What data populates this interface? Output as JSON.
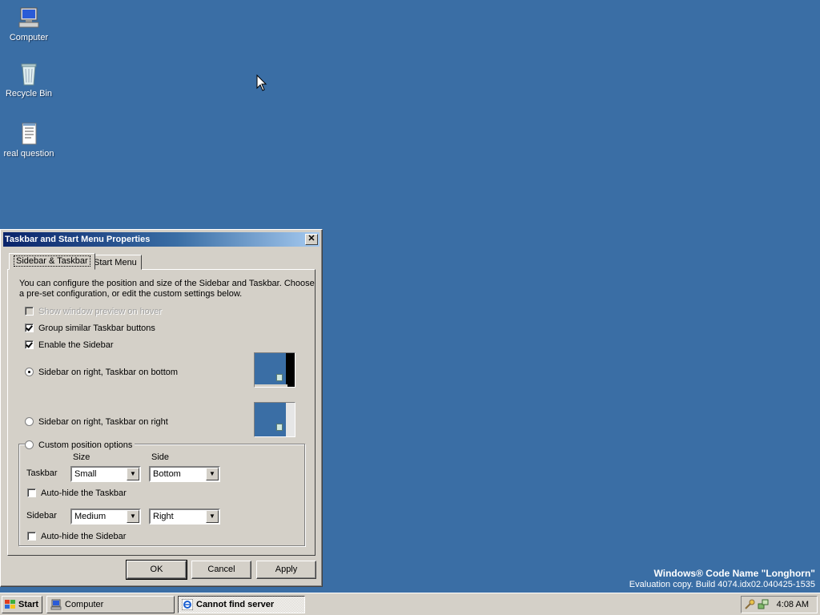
{
  "desktop": {
    "icons": [
      {
        "label": "Computer",
        "icon": "computer-icon"
      },
      {
        "label": "Recycle Bin",
        "icon": "recycle-bin-icon"
      },
      {
        "label": "real question",
        "icon": "text-document-icon"
      }
    ],
    "background_color": "#3a6ea5"
  },
  "dialog": {
    "title": "Taskbar and Start Menu Properties",
    "tabs": [
      {
        "label": "Sidebar & Taskbar",
        "active": true
      },
      {
        "label": "Start Menu",
        "active": false
      }
    ],
    "intro_text": "You can configure the position and size of the Sidebar and Taskbar. Choose a pre-set configuration, or edit the custom settings below.",
    "options": {
      "show_preview": {
        "label": "Show window preview on hover",
        "checked": false,
        "disabled": true
      },
      "group_buttons": {
        "label": "Group similar Taskbar buttons",
        "checked": true
      },
      "enable_sidebar": {
        "label": "Enable the Sidebar",
        "checked": true
      }
    },
    "layouts": {
      "right_bottom": {
        "label": "Sidebar on right, Taskbar on bottom",
        "selected": true
      },
      "right_right": {
        "label": "Sidebar on right, Taskbar on right",
        "selected": false
      },
      "custom": {
        "label": "Custom position options",
        "selected": false
      }
    },
    "custom": {
      "size_header": "Size",
      "side_header": "Side",
      "taskbar_label": "Taskbar",
      "taskbar_size": "Small",
      "taskbar_side": "Bottom",
      "autohide_taskbar": {
        "label": "Auto-hide the Taskbar",
        "checked": false
      },
      "sidebar_label": "Sidebar",
      "sidebar_size": "Medium",
      "sidebar_side": "Right",
      "autohide_sidebar": {
        "label": "Auto-hide the Sidebar",
        "checked": false
      }
    },
    "buttons": {
      "ok": "OK",
      "cancel": "Cancel",
      "apply": "Apply"
    }
  },
  "watermark": {
    "line1": "Windows® Code Name \"Longhorn\"",
    "line2": "Evaluation copy. Build 4074.idx02.040425-1535"
  },
  "taskbar": {
    "start_label": "Start",
    "tasks": [
      {
        "label": "Computer",
        "icon": "computer-icon",
        "active": false
      },
      {
        "label": "Cannot find server",
        "icon": "internet-explorer-icon",
        "active": true
      }
    ],
    "clock": "4:08 AM"
  }
}
